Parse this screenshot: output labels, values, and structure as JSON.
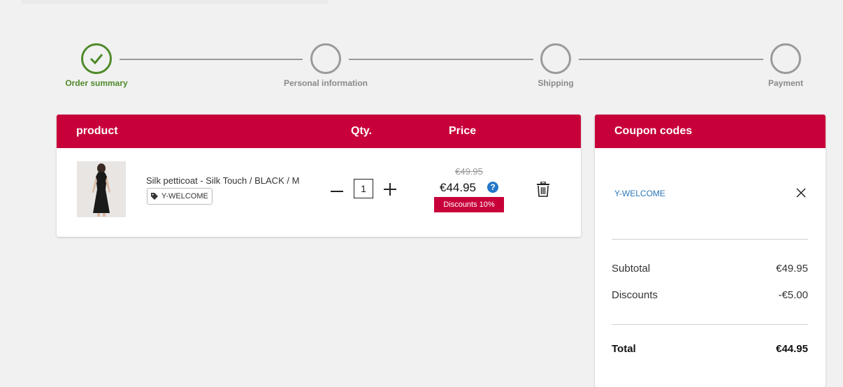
{
  "steps": [
    {
      "label": "Order summary",
      "state": "done"
    },
    {
      "label": "Personal information",
      "state": "pending"
    },
    {
      "label": "Shipping",
      "state": "pending"
    },
    {
      "label": "Payment",
      "state": "pending"
    }
  ],
  "cart": {
    "headers": {
      "product": "product",
      "qty": "Qty.",
      "price": "Price"
    },
    "item": {
      "name": "Silk petticoat - Silk Touch / BLACK / M",
      "coupon": "Y-WELCOME",
      "quantity": "1",
      "price_old": "€49.95",
      "price_new": "€44.95",
      "discount_badge": "Discounts 10%"
    }
  },
  "coupons": {
    "title": "Coupon codes",
    "applied_code": "Y-WELCOME",
    "subtotal_label": "Subtotal",
    "subtotal_value": "€49.95",
    "discounts_label": "Discounts",
    "discounts_value": "-€5.00",
    "total_label": "Total",
    "total_value": "€44.95"
  },
  "colors": {
    "brand": "#c8003a",
    "done": "#4f8a2a",
    "link": "#2b78b8",
    "help": "#2277c9"
  }
}
